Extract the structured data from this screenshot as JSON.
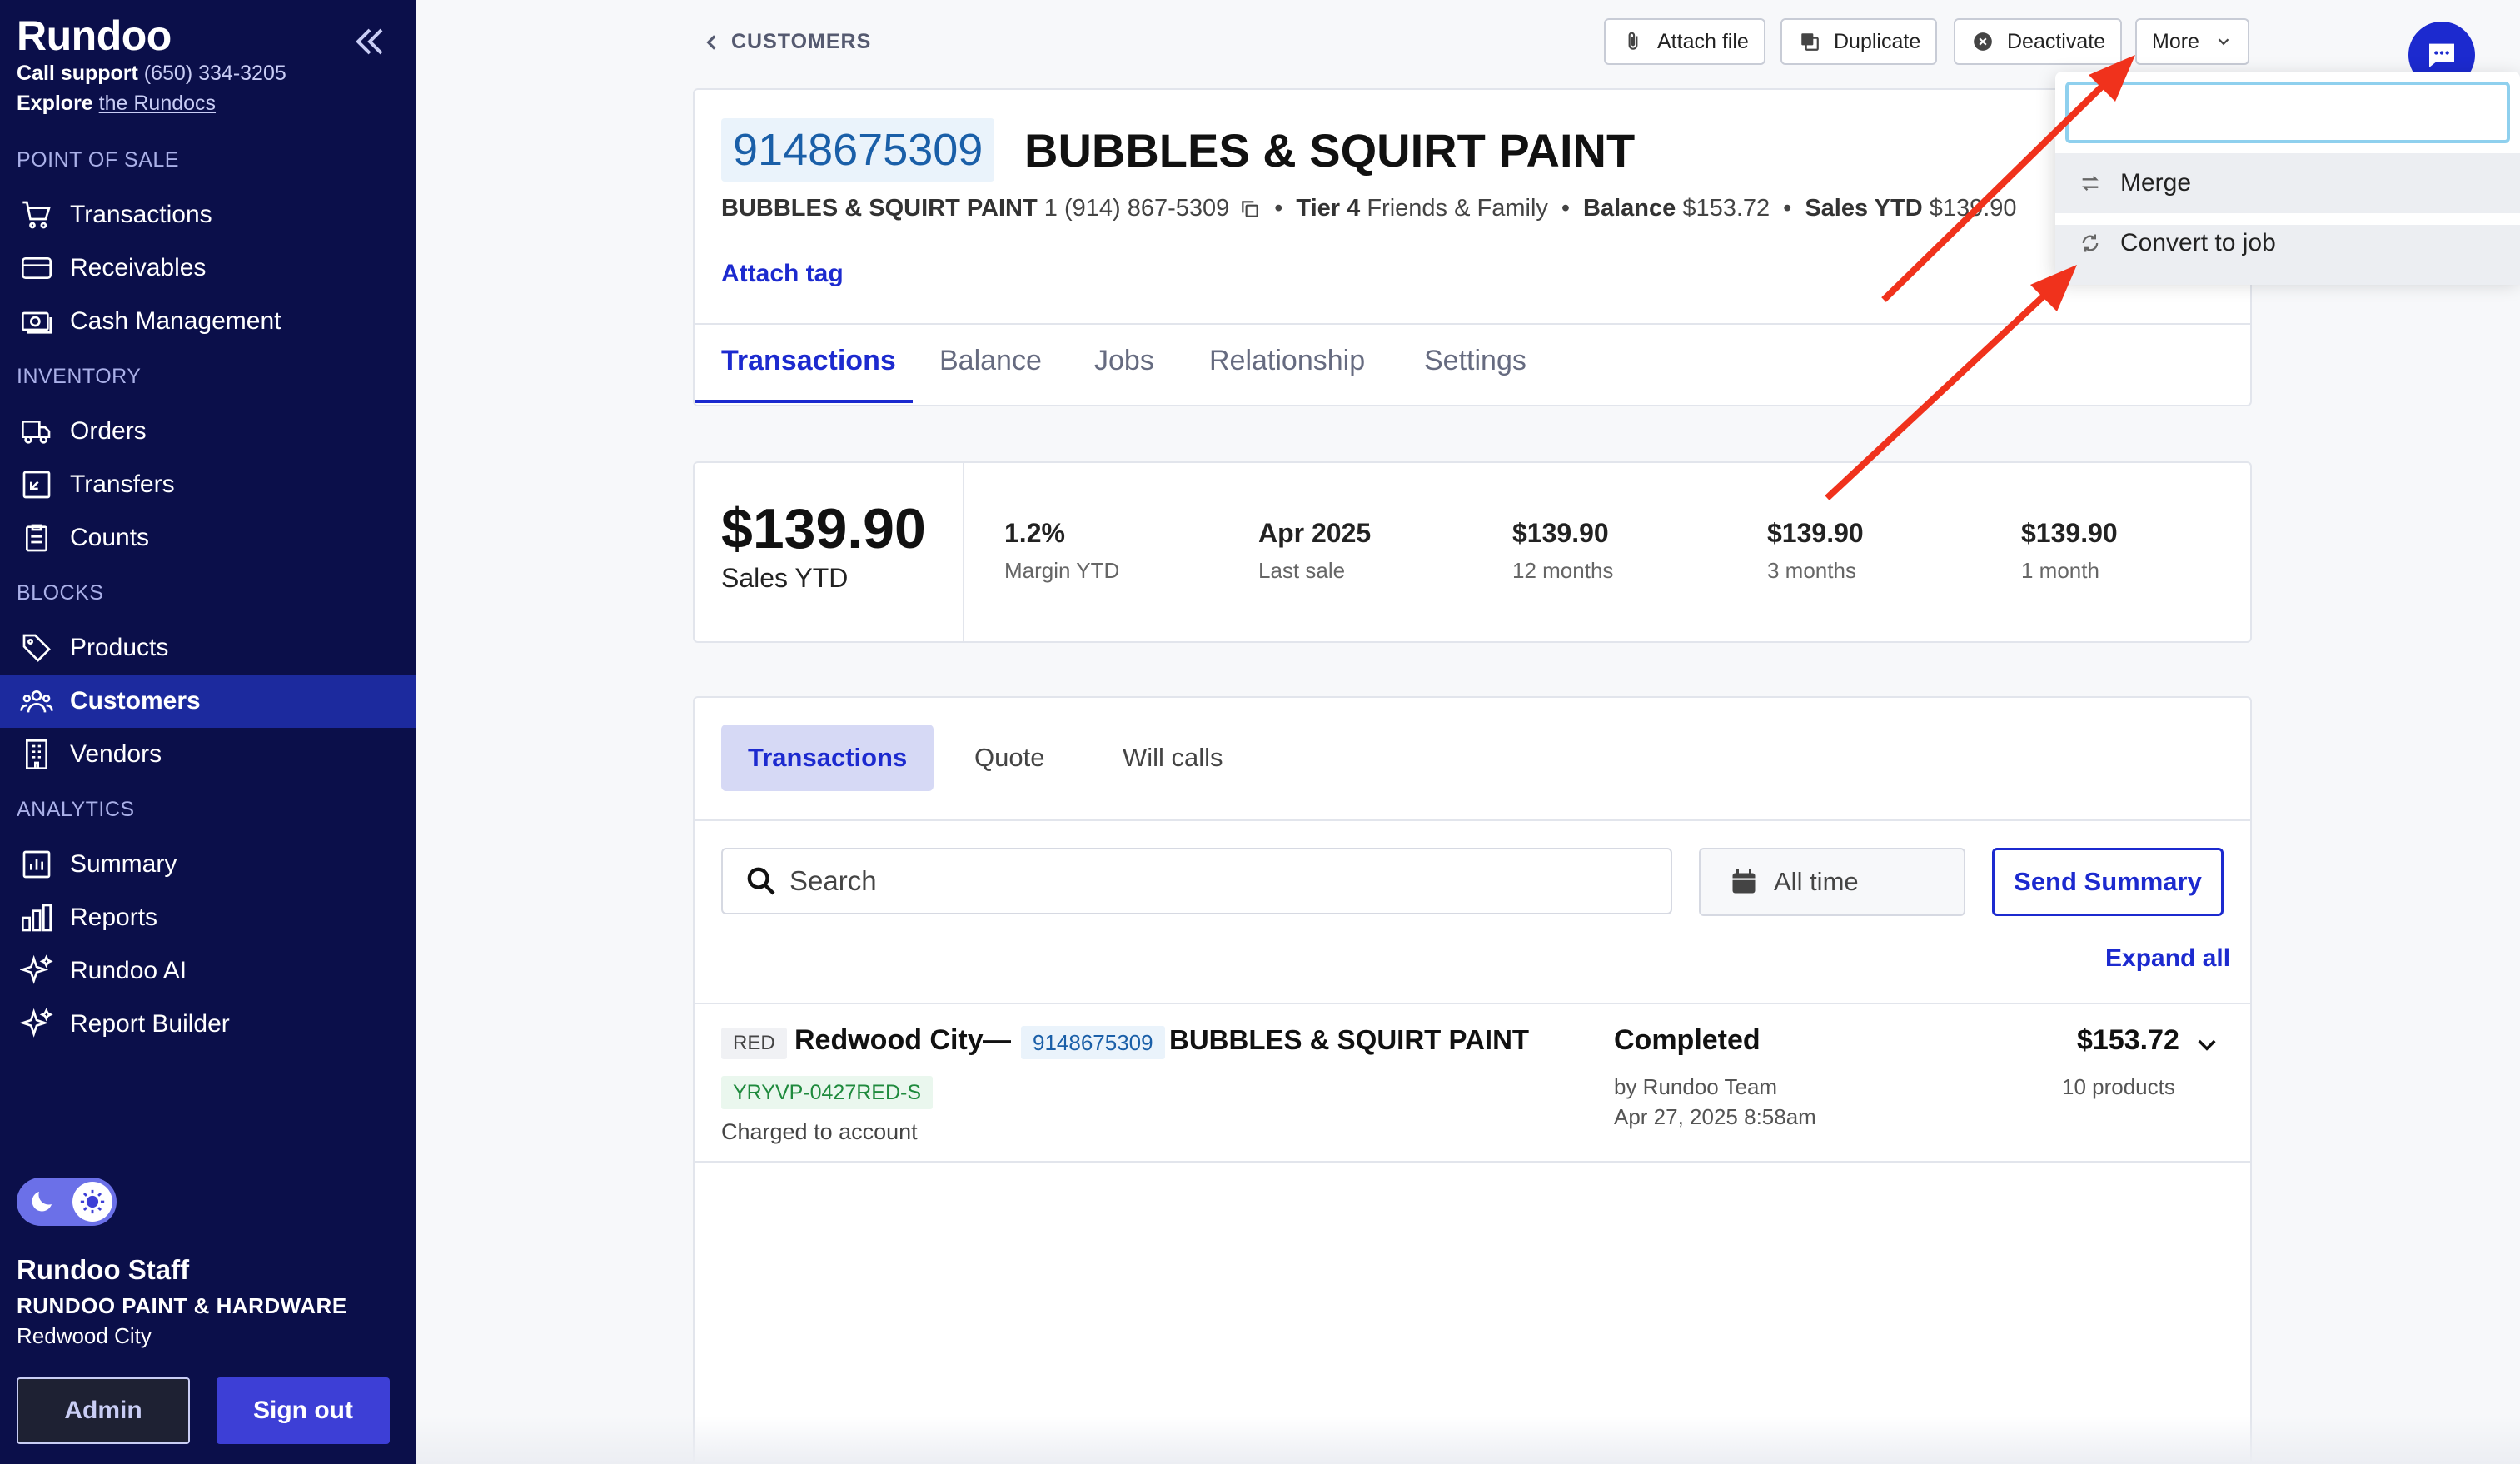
{
  "sidebar": {
    "brand": "Rundoo",
    "support_label": "Call support",
    "support_phone": "(650) 334-3205",
    "explore_label": "Explore",
    "explore_link": "the Rundocs",
    "sections": {
      "pos": "POINT OF SALE",
      "inventory": "INVENTORY",
      "blocks": "BLOCKS",
      "analytics": "ANALYTICS"
    },
    "items": {
      "transactions": "Transactions",
      "receivables": "Receivables",
      "cash": "Cash Management",
      "orders": "Orders",
      "transfers": "Transfers",
      "counts": "Counts",
      "products": "Products",
      "customers": "Customers",
      "vendors": "Vendors",
      "summary": "Summary",
      "reports": "Reports",
      "ai": "Rundoo AI",
      "builder": "Report Builder"
    },
    "user": {
      "name": "Rundoo Staff",
      "store": "RUNDOO PAINT & HARDWARE",
      "city": "Redwood City"
    },
    "admin_label": "Admin",
    "signout_label": "Sign out"
  },
  "topbar": {
    "breadcrumb": "CUSTOMERS",
    "attach_file": "Attach file",
    "duplicate": "Duplicate",
    "deactivate": "Deactivate",
    "more": "More"
  },
  "customer": {
    "phone": "9148675309",
    "name": "BUBBLES & SQUIRT PAINT",
    "sub_name": "BUBBLES & SQUIRT PAINT",
    "sub_phone": "1 (914) 867-5309",
    "tier_label": "Tier 4",
    "tier_group": "Friends & Family",
    "balance_label": "Balance",
    "balance_value": "$153.72",
    "sales_label": "Sales YTD",
    "sales_value": "$139.90",
    "attach_tag": "Attach tag"
  },
  "tabs": [
    "Transactions",
    "Balance",
    "Jobs",
    "Relationship",
    "Settings"
  ],
  "stats": {
    "big_value": "$139.90",
    "big_label": "Sales YTD",
    "items": [
      {
        "value": "1.2%",
        "label": "Margin YTD"
      },
      {
        "value": "Apr 2025",
        "label": "Last sale"
      },
      {
        "value": "$139.90",
        "label": "12 months"
      },
      {
        "value": "$139.90",
        "label": "3 months"
      },
      {
        "value": "$139.90",
        "label": "1 month"
      }
    ]
  },
  "subtabs": [
    "Transactions",
    "Quote",
    "Will calls"
  ],
  "filters": {
    "search_placeholder": "Search",
    "date_range": "All time",
    "send_summary": "Send Summary",
    "expand_all": "Expand all"
  },
  "transaction": {
    "store_code": "RED",
    "city": "Redwood City",
    "dash": "—",
    "phone": "9148675309",
    "customer": "BUBBLES & SQUIRT PAINT",
    "code": "YRYVP-0427RED-S",
    "payment": "Charged to account",
    "status": "Completed",
    "by": "by Rundoo Team",
    "date": "Apr 27, 2025 8:58am",
    "amount": "$153.72",
    "products": "10 products"
  },
  "dropdown": {
    "input_value": "",
    "merge": "Merge",
    "convert": "Convert to job"
  },
  "colors": {
    "sidebar_bg": "#0b0f4a",
    "accent": "#1c2acf",
    "annotation_arrow": "#f0321c"
  }
}
